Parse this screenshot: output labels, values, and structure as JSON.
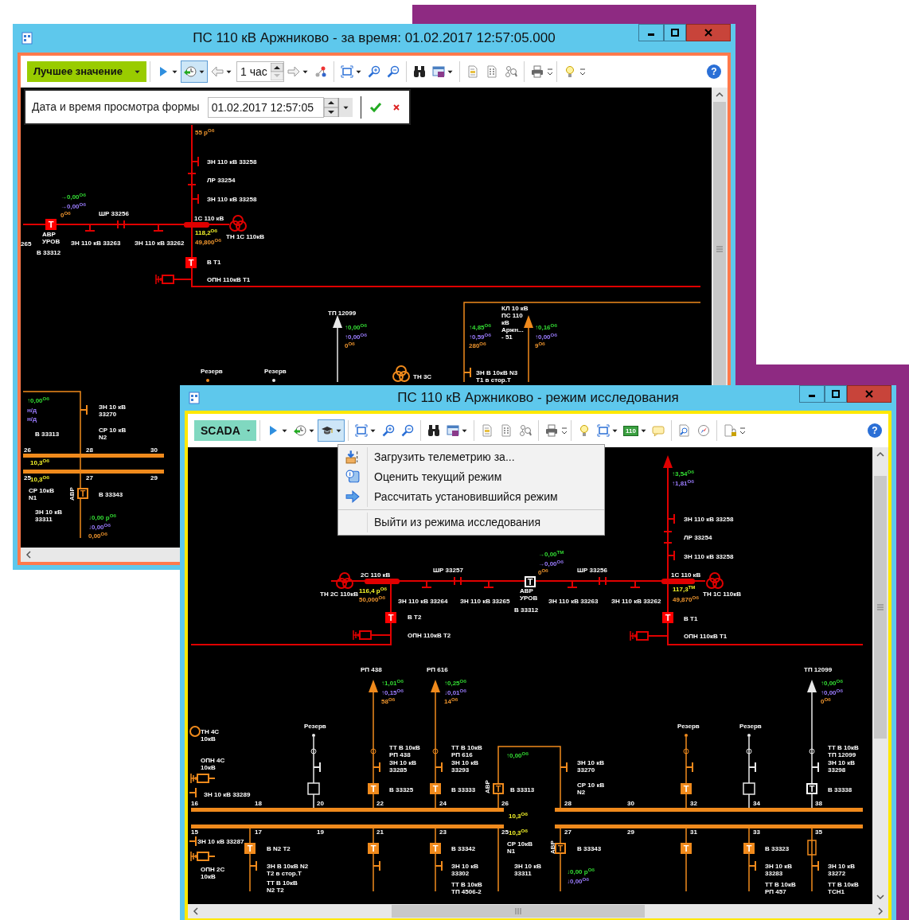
{
  "windows": [
    {
      "title": "ПС 110 кВ Аржниково - за время: 01.02.2017 12:57:05.000",
      "toolbar": {
        "mode": "Лучшее значение",
        "history_pressed": true,
        "interval": "1 час",
        "help": "?"
      },
      "date_popup": {
        "label": "Дата и время просмотра формы",
        "value": "01.02.2017 12:57:05"
      },
      "diagram": {
        "labels": [
          "ЗН 110 кВ 33258",
          "ЛР 33254",
          "ЗН 110 кВ 33258",
          "ШР 33256",
          "1С 110 кВ",
          "ТН 1С 110кВ",
          "АВР\nУРОВ",
          "265",
          "ЗН 110 кВ 33263",
          "ЗН 110 кВ 33262",
          "В 33312",
          "В Т1",
          "ОПН 110кВ Т1",
          "ТП 12099",
          "КЛ 10 кВ\nПС 110\nкВ\nАржн...\n- 51",
          "Резерв",
          "Резерв",
          "ТН 3С",
          "ЗН В 10кВ N3\nТ1 в стор.Т",
          "ЗН 10 кВ\n33270",
          "В 33313",
          "СР 10 кВ\nN2",
          "26",
          "28",
          "30",
          "25",
          "27",
          "29",
          "СР 10кВ\nN1",
          "В 33343",
          "ЗН 10 кВ\n33311"
        ],
        "vertical_labels": [
          "АВР"
        ],
        "readings": [
          {
            "text": "55 р$^{Об}$",
            "color": "#f0962e"
          },
          {
            "text": "→0,00$^{Об}$",
            "color": "#33dd33"
          },
          {
            "text": "→0,00$^{Об}$",
            "color": "#9b7cff"
          },
          {
            "text": "0$^{Об}$",
            "color": "#f0962e"
          },
          {
            "text": "118,2$^{Об}$",
            "color": "#f5f52a"
          },
          {
            "text": "49,800$^{Об}$",
            "color": "#f0962e"
          },
          {
            "text": "↑0,00$^{Об}$",
            "color": "#33dd33"
          },
          {
            "text": "↑0,00$^{Об}$",
            "color": "#9b7cff"
          },
          {
            "text": "0$^{Об}$",
            "color": "#f0962e"
          },
          {
            "text": "↑4,85$^{Об}$",
            "color": "#33dd33"
          },
          {
            "text": "↑0,59$^{Об}$",
            "color": "#9b7cff"
          },
          {
            "text": "280$^{Об}$",
            "color": "#f0962e"
          },
          {
            "text": "↑0,16$^{Об}$",
            "color": "#33dd33"
          },
          {
            "text": "↑0,00$^{Об}$",
            "color": "#9b7cff"
          },
          {
            "text": "9$^{Об}$",
            "color": "#f0962e"
          },
          {
            "text": "↑0,00$^{Об}$",
            "color": "#33dd33"
          },
          {
            "text": "н/д",
            "color": "#9b7cff"
          },
          {
            "text": "н/д",
            "color": "#9b7cff"
          },
          {
            "text": "10,3$^{Об}$",
            "color": "#f5f52a"
          },
          {
            "text": "10,3$^{Об}$",
            "color": "#f5f52a"
          },
          {
            "text": "↓0,00 р$^{Об}$",
            "color": "#33dd33"
          },
          {
            "text": "↓0,00$^{Об}$",
            "color": "#9b7cff"
          },
          {
            "text": "0,00$^{Об}$",
            "color": "#f0962e"
          }
        ],
        "breakers": [
          {
            "text": "T",
            "kind": "filled",
            "color": "#ff0000"
          },
          {
            "text": "T",
            "kind": "filled",
            "color": "#ff0000"
          },
          {
            "text": "T",
            "kind": "outline",
            "color": "#f08a1c"
          }
        ]
      }
    },
    {
      "title": "ПС 110 кВ Аржниково - режим исследования",
      "toolbar": {
        "mode": "SCADA",
        "research_pressed": true,
        "display": "110",
        "help": "?"
      },
      "menu": [
        {
          "text": "Загрузить телеметрию за...",
          "separator_before": false
        },
        {
          "text": "Оценить текущий режим",
          "separator_before": false
        },
        {
          "text": "Рассчитать установившийся режим",
          "separator_before": false
        },
        {
          "text": "Выйти из режима исследования",
          "separator_before": true
        }
      ],
      "diagram": {
        "labels": [
          "ЗН 110 кВ 33258",
          "ЛР 33254",
          "ЗН 110 кВ 33258",
          "ШР 33257",
          "ШР 33256",
          "2С 110 кВ",
          "1С 110 кВ",
          "ТН 2С 110кВ",
          "АВР\nУРОВ",
          "ТН 1С 110кВ",
          "ЗН 110 кВ 33264",
          "ЗН 110 кВ 33265",
          "ЗН 110 кВ 33263",
          "ЗН 110 кВ 33262",
          "В 33312",
          "В Т2",
          "В Т1",
          "ОПН 110кВ Т2",
          "ОПН 110кВ Т1",
          "РП 438",
          "РП 616",
          "ТП 12099",
          "Резерв",
          "Резерв",
          "Резерв",
          "ТН 4С\n10кВ",
          "ТТ В 10кВ\nРП 438",
          "ТТ В 10кВ\nРП 616",
          "ТТ В 10кВ\nТП 12099",
          "ОПН 4С\n10кВ",
          "ЗН 10 кВ\n33285",
          "ЗН 10 кВ\n33293",
          "ЗН 10 кВ\n33270",
          "ЗН 10 кВ\n33298",
          "ЗН 10 кВ 33289",
          "В 33325",
          "В 33333",
          "В 33313",
          "СР 10 кВ\nN2",
          "В 33338",
          "16",
          "18",
          "20",
          "22",
          "24",
          "26",
          "28",
          "30",
          "32",
          "34",
          "38",
          "15",
          "17",
          "19",
          "21",
          "23",
          "25",
          "27",
          "29",
          "31",
          "33",
          "35",
          "ЗН 10 кВ 33287",
          "В N2 Т2",
          "В 33342",
          "СР 10кВ\nN1",
          "В 33343",
          "В 33323",
          "ОПН 2С\n10кВ",
          "ЗН В 10кВ N2\nТ2 в стор.Т",
          "ЗН 10 кВ\n33302",
          "ЗН 10 кВ\n33311",
          "ЗН 10 кВ\n33283",
          "ЗН 10 кВ\n33272",
          "ТТ В 10кВ\nN2 Т2",
          "ТТ В 10кВ\nТП 4506-2",
          "ТТ В 10кВ\nРП 457",
          "ТТ В 10кВ\nТСН1"
        ],
        "vertical_labels": [
          "АВР",
          "АВР"
        ],
        "readings": [
          {
            "text": "↑3,54$^{Об}$",
            "color": "#33dd33"
          },
          {
            "text": "↑1,81$^{Об}$",
            "color": "#9b7cff"
          },
          {
            "text": "→0,00$^{ТМ}$",
            "color": "#33dd33"
          },
          {
            "text": "→0,00$^{Об}$",
            "color": "#9b7cff"
          },
          {
            "text": "0$^{Об}$",
            "color": "#f0962e"
          },
          {
            "text": "116,4 р$^{Об}$",
            "color": "#f5f52a"
          },
          {
            "text": "50,000$^{Об}$",
            "color": "#f0962e"
          },
          {
            "text": "117,3$^{ТМ}$",
            "color": "#f5f52a"
          },
          {
            "text": "49,870$^{Об}$",
            "color": "#f0962e"
          },
          {
            "text": "↑1,01$^{Об}$",
            "color": "#33dd33"
          },
          {
            "text": "↑0,15$^{Об}$",
            "color": "#9b7cff"
          },
          {
            "text": "58$^{Об}$",
            "color": "#f0962e"
          },
          {
            "text": "↑0,25$^{Об}$",
            "color": "#33dd33"
          },
          {
            "text": "↓0,01$^{Об}$",
            "color": "#9b7cff"
          },
          {
            "text": "14$^{Об}$",
            "color": "#f0962e"
          },
          {
            "text": "↑0,00$^{Об}$",
            "color": "#33dd33"
          },
          {
            "text": "↑0,00$^{Об}$",
            "color": "#9b7cff"
          },
          {
            "text": "0$^{Об}$",
            "color": "#f0962e"
          },
          {
            "text": "↑0,00$^{Об}$",
            "color": "#33dd33"
          },
          {
            "text": "10,3$^{Об}$",
            "color": "#f5f52a"
          },
          {
            "text": "10,3$^{Об}$",
            "color": "#f5f52a"
          },
          {
            "text": "↓0,00 р$^{Об}$",
            "color": "#33dd33"
          },
          {
            "text": "↓0,00$^{Об}$",
            "color": "#9b7cff"
          }
        ],
        "breakers": [
          {
            "text": "T",
            "kind": "outline",
            "color": "#ffffff"
          },
          {
            "text": "T",
            "kind": "filled",
            "color": "#ff0000"
          },
          {
            "text": "T",
            "kind": "filled",
            "color": "#ff0000"
          },
          {
            "text": "T",
            "kind": "filled",
            "color": "#f08a1c"
          },
          {
            "text": "T",
            "kind": "filled",
            "color": "#f08a1c"
          },
          {
            "text": "T",
            "kind": "outline",
            "color": "#f08a1c"
          },
          {
            "text": "T",
            "kind": "filled",
            "color": "#f08a1c"
          },
          {
            "text": "T",
            "kind": "outline",
            "color": "#ffffff"
          },
          {
            "text": "T",
            "kind": "filled",
            "color": "#f08a1c"
          },
          {
            "text": "T",
            "kind": "filled",
            "color": "#f08a1c"
          },
          {
            "text": "T",
            "kind": "filled",
            "color": "#f08a1c"
          },
          {
            "text": "T",
            "kind": "outline",
            "color": "#f08a1c"
          },
          {
            "text": "T",
            "kind": "filled",
            "color": "#f08a1c"
          },
          {
            "text": "T",
            "kind": "filled",
            "color": "#f08a1c"
          }
        ]
      }
    }
  ]
}
